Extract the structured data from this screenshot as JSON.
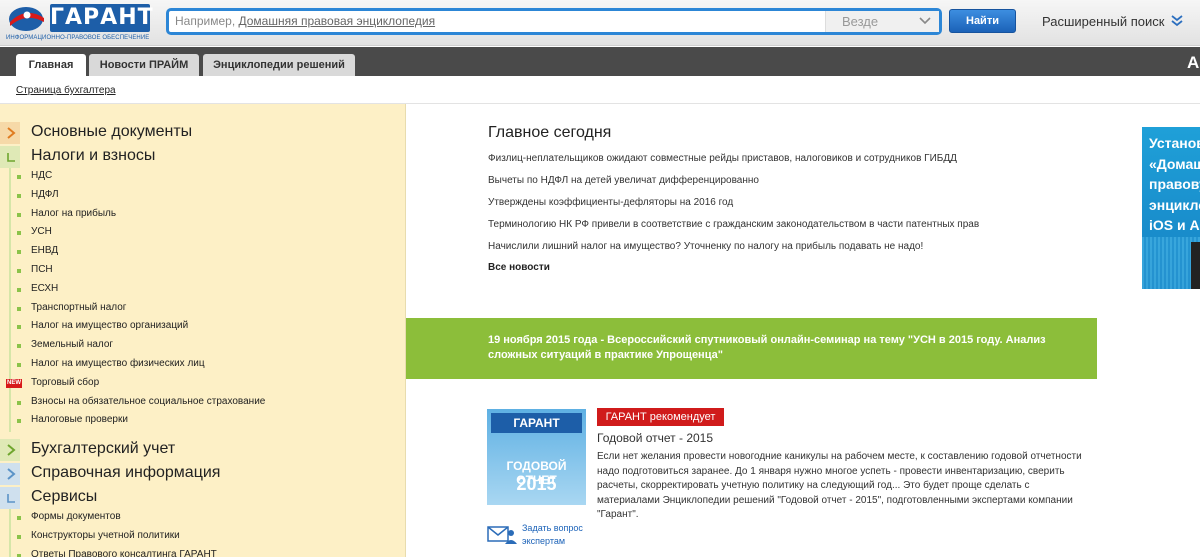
{
  "header": {
    "logo_text": "ГАРАНТ",
    "logo_tagline": "ИНФОРМАЦИОННО-ПРАВОВОЕ ОБЕСПЕЧЕНИЕ",
    "search_prefix": "Например,",
    "search_example": "Домашняя правовая энциклопедия",
    "scope_value": "Везде",
    "find_label": "Найти",
    "advanced_search": "Расширенный поиск"
  },
  "tabs": [
    {
      "label": "Главная",
      "active": true
    },
    {
      "label": "Новости ПРАЙМ",
      "active": false
    },
    {
      "label": "Энциклопедии решений",
      "active": false
    }
  ],
  "tab_right_letter": "А",
  "breadcrumb": "Страница бухгалтера",
  "sidebar": {
    "sections": [
      {
        "label": "Основные документы",
        "color": "#f0a050"
      },
      {
        "label": "Налоги и взносы",
        "color": "#8bc34a"
      },
      {
        "label": "Бухгалтерский учет",
        "color": "#8bc34a"
      },
      {
        "label": "Справочная информация",
        "color": "#7fb0d8"
      },
      {
        "label": "Сервисы",
        "color": "#7fb0d8"
      }
    ],
    "tax_items": [
      "НДС",
      "НДФЛ",
      "Налог на прибыль",
      "УСН",
      "ЕНВД",
      "ПСН",
      "ЕСХН",
      "Транспортный налог",
      "Налог на имущество организаций",
      "Земельный налог",
      "Налог на имущество физических лиц",
      "Торговый сбор",
      "Взносы на обязательное социальное страхование",
      "Налоговые проверки"
    ],
    "new_badge": "NEW",
    "service_items": [
      "Формы документов",
      "Конструкторы учетной политики",
      "Ответы Правового консалтинга ГАРАНТ"
    ]
  },
  "main": {
    "title": "Главное сегодня",
    "news": [
      "Физлиц-неплательщиков ожидают совместные рейды приставов, налоговиков и сотрудников ГИБДД",
      "Вычеты по НДФЛ на детей увеличат дифференцированно",
      "Утверждены коэффициенты-дефляторы на 2016 год",
      "Терминологию НК РФ привели в соответствие с гражданским законодательством в части патентных прав",
      "Начислили лишний налог на имущество? Уточненку по налогу на прибыль подавать не надо!"
    ],
    "all_news": "Все новости",
    "banner": "19 ноября 2015 года - Всероссийский спутниковый онлайн-семинар на тему \"УСН в 2015 году. Анализ сложных ситуаций в практике Упрощенца\"",
    "rec_badge": "ГАРАНТ рекомендует",
    "rec_title": "Годовой отчет - 2015",
    "rec_text": "Если нет желания провести новогодние каникулы на рабочем месте, к составлению годовой отчетности надо подготовиться заранее. До 1 января нужно многое успеть - провести инвентаризацию, сверить расчеты, скорректировать учетную политику на следующий год... Это будет проще сделать с материалами Энциклопедии решений \"Годовой отчет - 2015\", подготовленными экспертами компании \"Гарант\".",
    "rec_image_logo": "ГАРАНТ",
    "rec_image_caption": "ГОДОВОЙ ОТЧЕТ",
    "rec_image_year": "2015",
    "ask_expert": "Задать вопрос экспертам"
  },
  "ad": {
    "text": "Установи «Домашнюю правовую энциклопедию» для iOS и Android"
  },
  "colors": {
    "accent_blue": "#1b62b8",
    "banner_green": "#8cbe3a",
    "badge_red": "#d01b1b",
    "sidebar_bg": "#fdf0c6"
  }
}
